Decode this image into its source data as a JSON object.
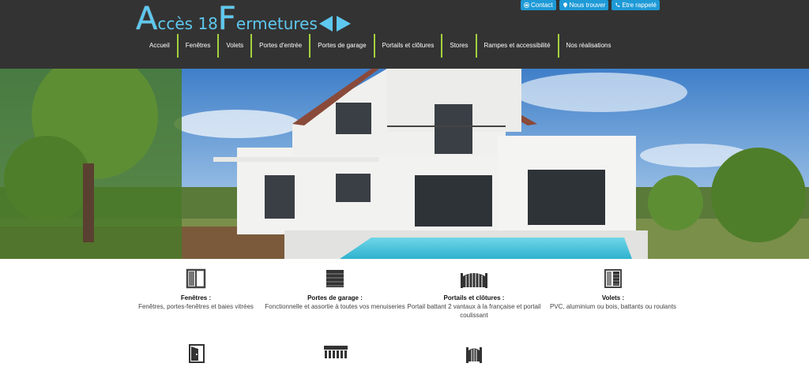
{
  "logo": {
    "a": "A",
    "cces": "ccès 18 ",
    "f": "F",
    "ermetures": "ermetures"
  },
  "top_buttons": [
    {
      "label": "Contact",
      "icon": "envelope-icon"
    },
    {
      "label": "Nous trouver",
      "icon": "map-pin-icon"
    },
    {
      "label": "Etre rappelé",
      "icon": "phone-icon"
    }
  ],
  "nav": [
    {
      "label": "Accueil"
    },
    {
      "label": "Fenêtres"
    },
    {
      "label": "Volets"
    },
    {
      "label": "Portes d'entrée"
    },
    {
      "label": "Portes de garage"
    },
    {
      "label": "Portails et clôtures"
    },
    {
      "label": "Stores"
    },
    {
      "label": "Rampes et accessibilité"
    },
    {
      "label": "Nos réalisations"
    }
  ],
  "features": [
    {
      "title": "Fenêtres :",
      "desc": "Fenêtres, portes-fenêtres et baies vitrées",
      "icon": "window-icon"
    },
    {
      "title": "Portes de garage :",
      "desc": "Fonctionnelle et assortie à toutes vos menuiseries",
      "icon": "garage-door-icon"
    },
    {
      "title": "Portails et clôtures :",
      "desc": "Portail battant 2 vantaux à la française et portail coulissant",
      "icon": "gate-icon"
    },
    {
      "title": "Volets :",
      "desc": "PVC, aluminium ou bois, battants ou roulants",
      "icon": "shutter-icon"
    }
  ],
  "features_row2": [
    {
      "icon": "entry-door-icon"
    },
    {
      "icon": "awning-icon"
    },
    {
      "icon": "fence-icon"
    }
  ],
  "colors": {
    "header_bg": "#333333",
    "accent_blue": "#1e9ad6",
    "logo_blue": "#5ec8ef",
    "nav_separator": "#a3d13f"
  }
}
